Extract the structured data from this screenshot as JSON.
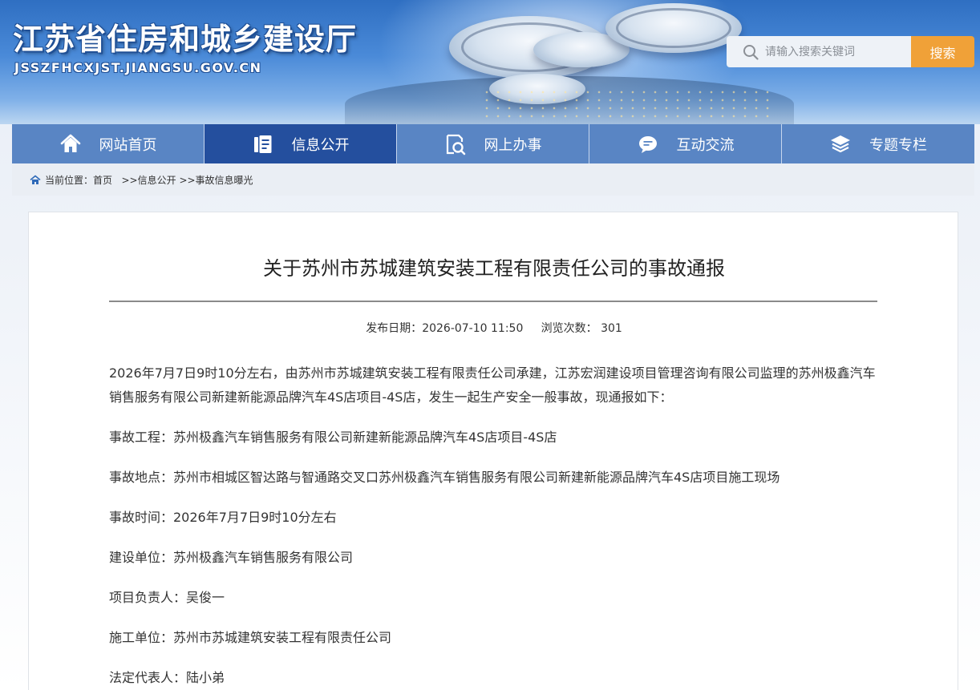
{
  "header": {
    "site_title": "江苏省住房和城乡建设厅",
    "site_domain": "JSSZFHCXJST.JIANGSU.GOV.CN",
    "search_placeholder": "请输入搜索关键词",
    "search_button": "搜索"
  },
  "nav": {
    "items": [
      {
        "label": "网站首页",
        "icon": "home-icon"
      },
      {
        "label": "信息公开",
        "icon": "document-icon",
        "active": true
      },
      {
        "label": "网上办事",
        "icon": "magnifier-document-icon"
      },
      {
        "label": "互动交流",
        "icon": "chat-bubble-icon"
      },
      {
        "label": "专题专栏",
        "icon": "layers-icon"
      }
    ]
  },
  "breadcrumb": {
    "prefix": "当前位置：",
    "items": [
      "首页",
      ">>信息公开",
      ">>事故信息曝光"
    ]
  },
  "article": {
    "title": "关于苏州市苏城建筑安装工程有限责任公司的事故通报",
    "date_label": "发布日期：",
    "date": "2026-07-10 11:50",
    "views_label": "浏览次数：",
    "views": "301",
    "paragraphs": [
      "2026年7月7日9时10分左右，由苏州市苏城建筑安装工程有限责任公司承建，江苏宏润建设项目管理咨询有限公司监理的苏州极鑫汽车销售服务有限公司新建新能源品牌汽车4S店项目-4S店，发生一起生产安全一般事故，现通报如下：",
      "事故工程：苏州极鑫汽车销售服务有限公司新建新能源品牌汽车4S店项目-4S店",
      "事故地点：苏州市相城区智达路与智通路交叉口苏州极鑫汽车销售服务有限公司新建新能源品牌汽车4S店项目施工现场",
      "事故时间：2026年7月7日9时10分左右",
      "建设单位：苏州极鑫汽车销售服务有限公司",
      "项目负责人：吴俊一",
      "施工单位：苏州市苏城建筑安装工程有限责任公司",
      "法定代表人：陆小弟"
    ]
  },
  "colors": {
    "nav_bg": "#5985c4",
    "nav_active": "#244f9e",
    "search_button": "#f0a138"
  }
}
